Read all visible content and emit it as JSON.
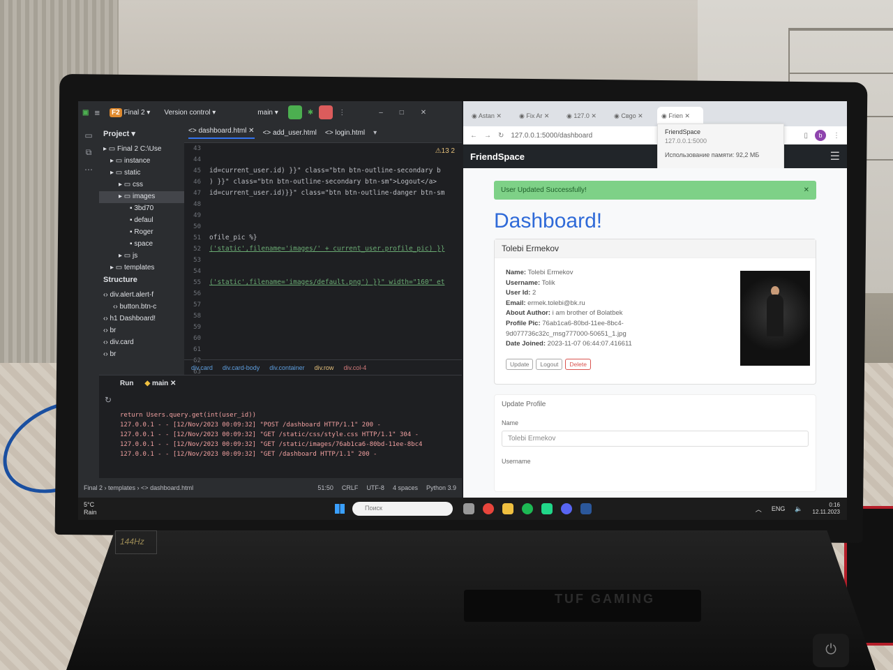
{
  "ide": {
    "project_badge": "F2",
    "project_name": "Final 2",
    "vcs_label": "Version control",
    "branch": "main",
    "project_panel_title": "Project",
    "tree": [
      {
        "label": "Final 2  C:\\Use",
        "sel": false
      },
      {
        "label": "instance",
        "sel": false
      },
      {
        "label": "static",
        "sel": false
      },
      {
        "label": "css",
        "sel": false
      },
      {
        "label": "images",
        "sel": true
      },
      {
        "label": "3bd70",
        "sel": false
      },
      {
        "label": "defaul",
        "sel": false
      },
      {
        "label": "Roger",
        "sel": false
      },
      {
        "label": "space",
        "sel": false
      },
      {
        "label": "js",
        "sel": false
      },
      {
        "label": "templates",
        "sel": false
      }
    ],
    "structure_title": "Structure",
    "structure": [
      "div.alert.alert-f",
      "button.btn-c",
      "h1  Dashboard!",
      "br",
      "div.card",
      "br"
    ],
    "tabs": [
      "dashboard.html",
      "add_user.html",
      "login.html"
    ],
    "inspection": "13  2",
    "line_numbers": [
      "43",
      "44",
      "45",
      "46",
      "47",
      "48",
      "49",
      "50",
      "51",
      "52",
      "53",
      "54",
      "55",
      "56",
      "57",
      "58",
      "59",
      "60",
      "61",
      "62",
      "63"
    ],
    "code_lines": [
      "",
      "",
      "id=current_user.id) }}\" class=\"btn btn-outline-secondary b",
      ") }}\" class=\"btn btn-outline-secondary btn-sm\">Logout</a>",
      "id=current_user.id)}}\" class=\"btn btn-outline-danger btn-sm",
      "",
      "",
      "",
      "ofile_pic %}",
      "('static',filename='images/' + current_user.profile_pic) }}",
      "",
      "",
      "('static',filename='images/default.png') }}\" width=\"160\" et",
      "",
      "",
      "",
      "",
      "",
      "",
      "",
      ""
    ],
    "breadcrumbs": [
      "div.card",
      "div.card-body",
      "div.container",
      "div.row",
      "div.col-4"
    ],
    "run_label": "Run",
    "run_config": "main",
    "console": [
      "return Users.query.get(int(user_id))",
      "127.0.0.1 - - [12/Nov/2023 00:09:32] \"POST /dashboard HTTP/1.1\" 200 -",
      "127.0.0.1 - - [12/Nov/2023 00:09:32] \"GET /static/css/style.css HTTP/1.1\" 304 -",
      "127.0.0.1 - - [12/Nov/2023 00:09:32] \"GET /static/images/76ab1ca6-80bd-11ee-8bc4",
      "127.0.0.1 - - [12/Nov/2023 00:09:32] \"GET /dashboard HTTP/1.1\" 200 -"
    ],
    "status": {
      "path": [
        "Final 2",
        "templates",
        "dashboard.html"
      ],
      "position": "51:50",
      "line_sep": "CRLF",
      "encoding": "UTF-8",
      "indent": "4 spaces",
      "interpreter": "Python 3.9"
    }
  },
  "browser": {
    "tabs": [
      "Astan",
      "Fix Ar",
      "127.0",
      "Свgo",
      "Frien"
    ],
    "url": "127.0.0.1:5000/dashboard",
    "profile_letter": "b",
    "tooltip": {
      "title": "FriendSpace",
      "url": "127.0.0.1:5000",
      "memory": "Использование памяти: 92,2 МБ"
    },
    "brand": "FriendSpace",
    "alert": "User Updated Successfully!",
    "heading": "Dashboard!",
    "card_title": "Tolebi Ermekov",
    "fields": [
      {
        "k": "Name:",
        "v": "Tolebi Ermekov"
      },
      {
        "k": "Username:",
        "v": "Tolik"
      },
      {
        "k": "User Id:",
        "v": "2"
      },
      {
        "k": "Email:",
        "v": "ermek.tolebi@bk.ru"
      },
      {
        "k": "About Author:",
        "v": "i am brother of Bolatbek"
      },
      {
        "k": "Profile Pic:",
        "v": "76ab1ca6-80bd-11ee-8bc4-"
      },
      {
        "k": "",
        "v": "9d077736c32c_msg777000-50651_1.jpg"
      },
      {
        "k": "Date Joined:",
        "v": "2023-11-07 06:44:07.416611"
      }
    ],
    "buttons": {
      "update": "Update",
      "logout": "Logout",
      "delete": "Delete"
    },
    "update_section": "Update Profile",
    "name_label": "Name",
    "name_value": "Tolebi Ermekov",
    "username_label": "Username"
  },
  "taskbar": {
    "temp": "5°C",
    "weather": "Rain",
    "search_placeholder": "Поиск",
    "lang": "ENG",
    "time": "0:16",
    "date": "12.11.2023"
  },
  "laptop": {
    "refresh_badge": "144Hz",
    "brand_text": "TUF GAMING"
  },
  "colors": {
    "ide_bg": "#1e1f22",
    "navbar": "#212529",
    "alert_bg": "#7ed187",
    "heading": "#2f6ad8",
    "danger": "#d9534f"
  }
}
